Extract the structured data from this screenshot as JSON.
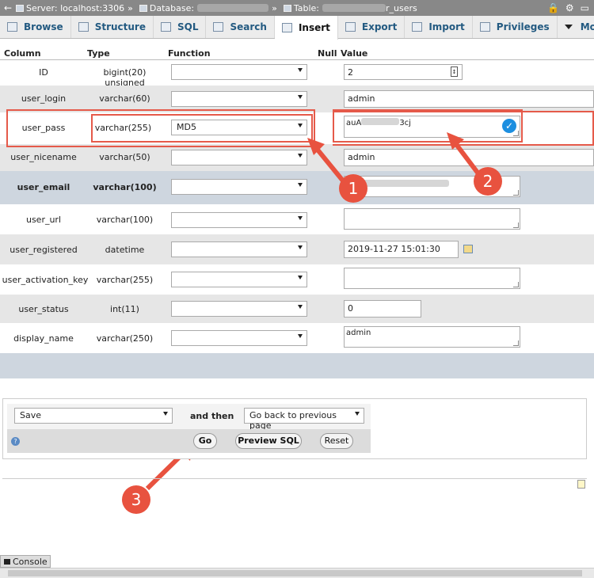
{
  "breadcrumb": {
    "server_label": "Server: localhost:3306",
    "database_label": "Database:",
    "table_label": "Table:",
    "table_suffix": "r_users",
    "sep": "»"
  },
  "tabs": [
    {
      "label": "Browse",
      "icon": "browse-icon"
    },
    {
      "label": "Structure",
      "icon": "structure-icon"
    },
    {
      "label": "SQL",
      "icon": "sql-icon"
    },
    {
      "label": "Search",
      "icon": "search-icon"
    },
    {
      "label": "Insert",
      "icon": "insert-icon",
      "active": true
    },
    {
      "label": "Export",
      "icon": "export-icon"
    },
    {
      "label": "Import",
      "icon": "import-icon"
    },
    {
      "label": "Privileges",
      "icon": "privileges-icon"
    },
    {
      "label": "More",
      "icon": "chevron-down-icon"
    }
  ],
  "headers": {
    "column": "Column",
    "type": "Type",
    "function": "Function",
    "null": "Null",
    "value": "Value"
  },
  "rows": [
    {
      "column": "ID",
      "type": "bigint(20) unsigned",
      "function": "",
      "value": "2"
    },
    {
      "column": "user_login",
      "type": "varchar(60)",
      "function": "",
      "value": "admin"
    },
    {
      "column": "user_pass",
      "type": "varchar(255)",
      "function": "MD5",
      "value_prefix": "auA",
      "value_suffix": "3cj"
    },
    {
      "column": "user_nicename",
      "type": "varchar(50)",
      "function": "",
      "value": "admin"
    },
    {
      "column": "user_email",
      "type": "varchar(100)",
      "function": "",
      "value": ""
    },
    {
      "column": "user_url",
      "type": "varchar(100)",
      "function": "",
      "value": ""
    },
    {
      "column": "user_registered",
      "type": "datetime",
      "function": "",
      "value": "2019-11-27 15:01:30"
    },
    {
      "column": "user_activation_key",
      "type": "varchar(255)",
      "function": "",
      "value": ""
    },
    {
      "column": "user_status",
      "type": "int(11)",
      "function": "",
      "value": "0"
    },
    {
      "column": "display_name",
      "type": "varchar(250)",
      "function": "",
      "value": "admin"
    }
  ],
  "save": {
    "action": "Save",
    "and_then": "and then",
    "after": "Go back to previous page",
    "go": "Go",
    "preview": "Preview SQL",
    "reset": "Reset"
  },
  "annotations": [
    "1",
    "2",
    "3"
  ],
  "console": "Console",
  "colors": {
    "accent_red": "#e8523f",
    "highlight_row": "#ced6df",
    "tab_text": "#235a81"
  }
}
